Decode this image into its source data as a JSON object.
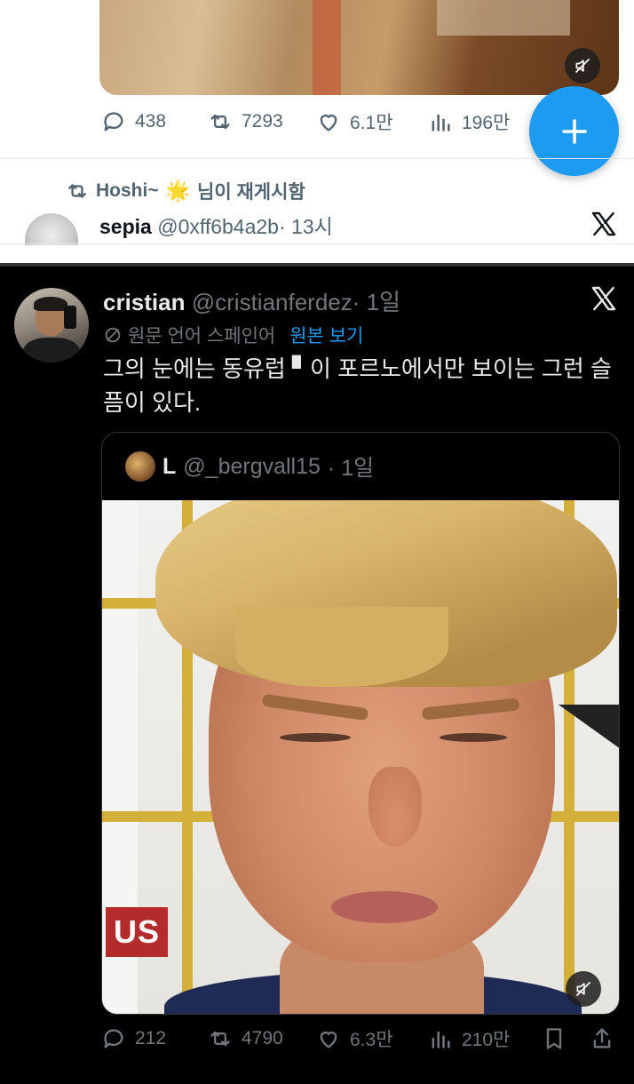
{
  "top_tweet": {
    "stats": {
      "replies": "438",
      "reposts": "7293",
      "likes": "6.1만",
      "views": "196만"
    },
    "media_muted_icon": "speaker-muted-icon"
  },
  "fab": {
    "icon": "plus-icon",
    "color": "#1d9bf0"
  },
  "repost_notice": {
    "user": "Hoshi~",
    "suffix": "님이 재게시함",
    "emoji": "🌟"
  },
  "sepia_tweet": {
    "name": "sepia",
    "handle": "@0xff6b4a2b",
    "time": "· 13시"
  },
  "main_tweet": {
    "name": "cristian",
    "handle": "@cristianferdez",
    "time": "· 1일",
    "translation_label": "원문 언어 스페인어",
    "view_original": "원본 보기",
    "text": "그의 눈에는 동유럽 ▘이 포르노에서만 보이는 그런 슬픔이 있다.",
    "quote": {
      "name": "L",
      "handle": "@_bergvall15",
      "time": "· 1일",
      "media_logo_text": "US"
    },
    "stats": {
      "replies": "212",
      "reposts": "4790",
      "likes": "6.3만",
      "views": "210만"
    }
  },
  "colors": {
    "accent": "#1d9bf0",
    "dark_bg": "#000000",
    "muted_text": "#71767b"
  }
}
